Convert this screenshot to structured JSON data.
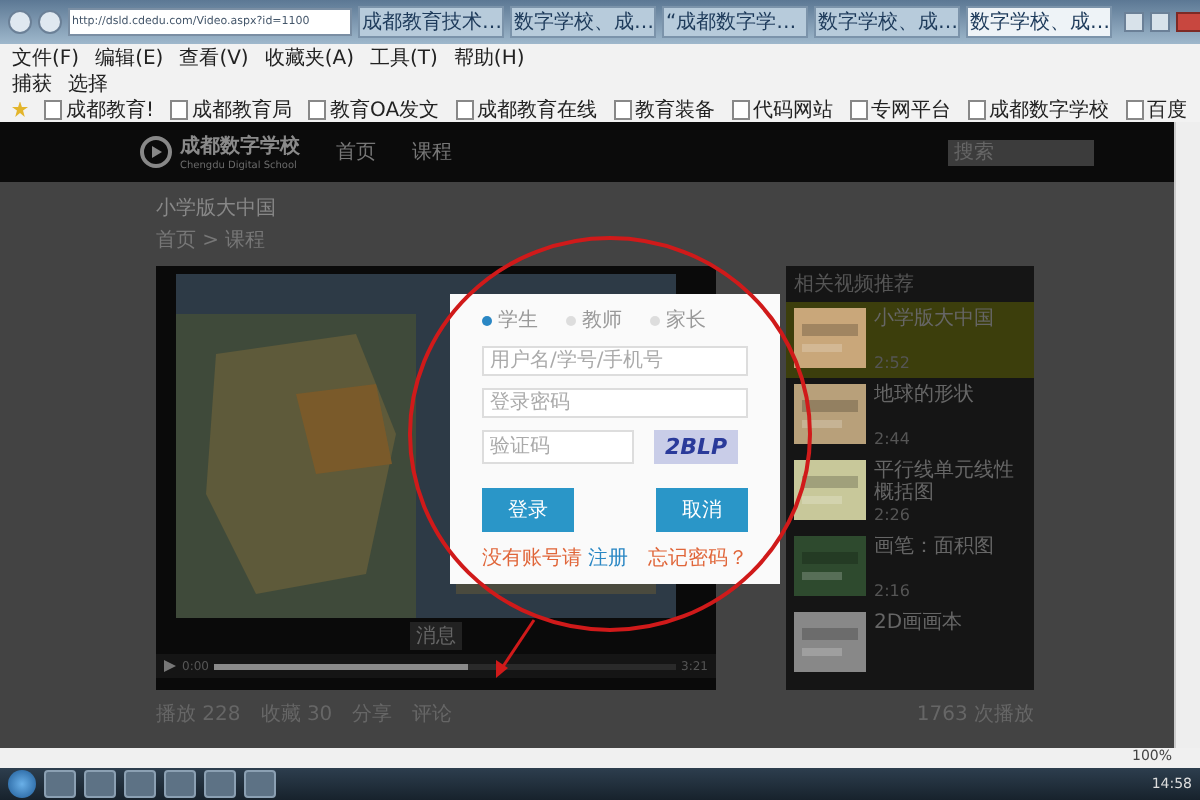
{
  "browser": {
    "url": "http://dsld.cdedu.com/Video.aspx?id=1100",
    "tabs": [
      {
        "title": "成都教育技术…",
        "selected": false
      },
      {
        "title": "数字学校、成…",
        "selected": false
      },
      {
        "title": "“成都数字学…",
        "selected": false
      },
      {
        "title": "数字学校、成…",
        "selected": false
      },
      {
        "title": "数字学校、成…",
        "selected": true
      }
    ],
    "menu": [
      "文件(F)",
      "编辑(E)",
      "查看(V)",
      "收藏夹(A)",
      "工具(T)",
      "帮助(H)"
    ],
    "commands": [
      "捕获",
      "选择"
    ],
    "favorites": [
      "成都教育!",
      "成都教育局",
      "教育OA发文",
      "成都教育在线",
      "教育装备",
      "代码网站",
      "专网平台",
      "成都数字学校",
      "百度"
    ]
  },
  "site": {
    "logo_title": "成都数字学校",
    "logo_subtitle": "Chengdu Digital School",
    "nav": [
      "首页",
      "课程"
    ],
    "search_placeholder": "搜索"
  },
  "page": {
    "title": "小学版大中国",
    "breadcrumb": "首页 > 课程"
  },
  "player": {
    "time": "0:00",
    "duration": "3:21",
    "level": 0.55,
    "caption": "消息"
  },
  "stats": [
    {
      "label": "播放 228"
    },
    {
      "label": "收藏 30"
    },
    {
      "label": "分享"
    },
    {
      "label": "评论"
    }
  ],
  "views": "1763 次播放",
  "sidebar": {
    "title": "相关视频推荐",
    "items": [
      {
        "title": "小学版大中国",
        "duration": "2:52",
        "selected": true
      },
      {
        "title": "地球的形状",
        "duration": "2:44",
        "selected": false
      },
      {
        "title": "平行线单元线性概括图",
        "duration": "2:26",
        "selected": false
      },
      {
        "title": "画笔：面积图",
        "duration": "2:16",
        "selected": false
      },
      {
        "title": "2D画画本",
        "selected": false
      }
    ]
  },
  "login": {
    "roles": [
      {
        "label": "学生",
        "selected": true
      },
      {
        "label": "教师",
        "selected": false
      },
      {
        "label": "家长",
        "selected": false
      }
    ],
    "username_placeholder": "用户名/学号/手机号",
    "password_placeholder": "登录密码",
    "captcha_placeholder": "验证码",
    "captcha": "2BLP",
    "login_button": "登录",
    "cancel_button": "取消",
    "register_text": "没有账号请",
    "register_link": "注册",
    "forgot_link": "忘记密码？"
  },
  "status": {
    "zoom": "100%"
  },
  "taskbar": {
    "clock": "14:58"
  }
}
